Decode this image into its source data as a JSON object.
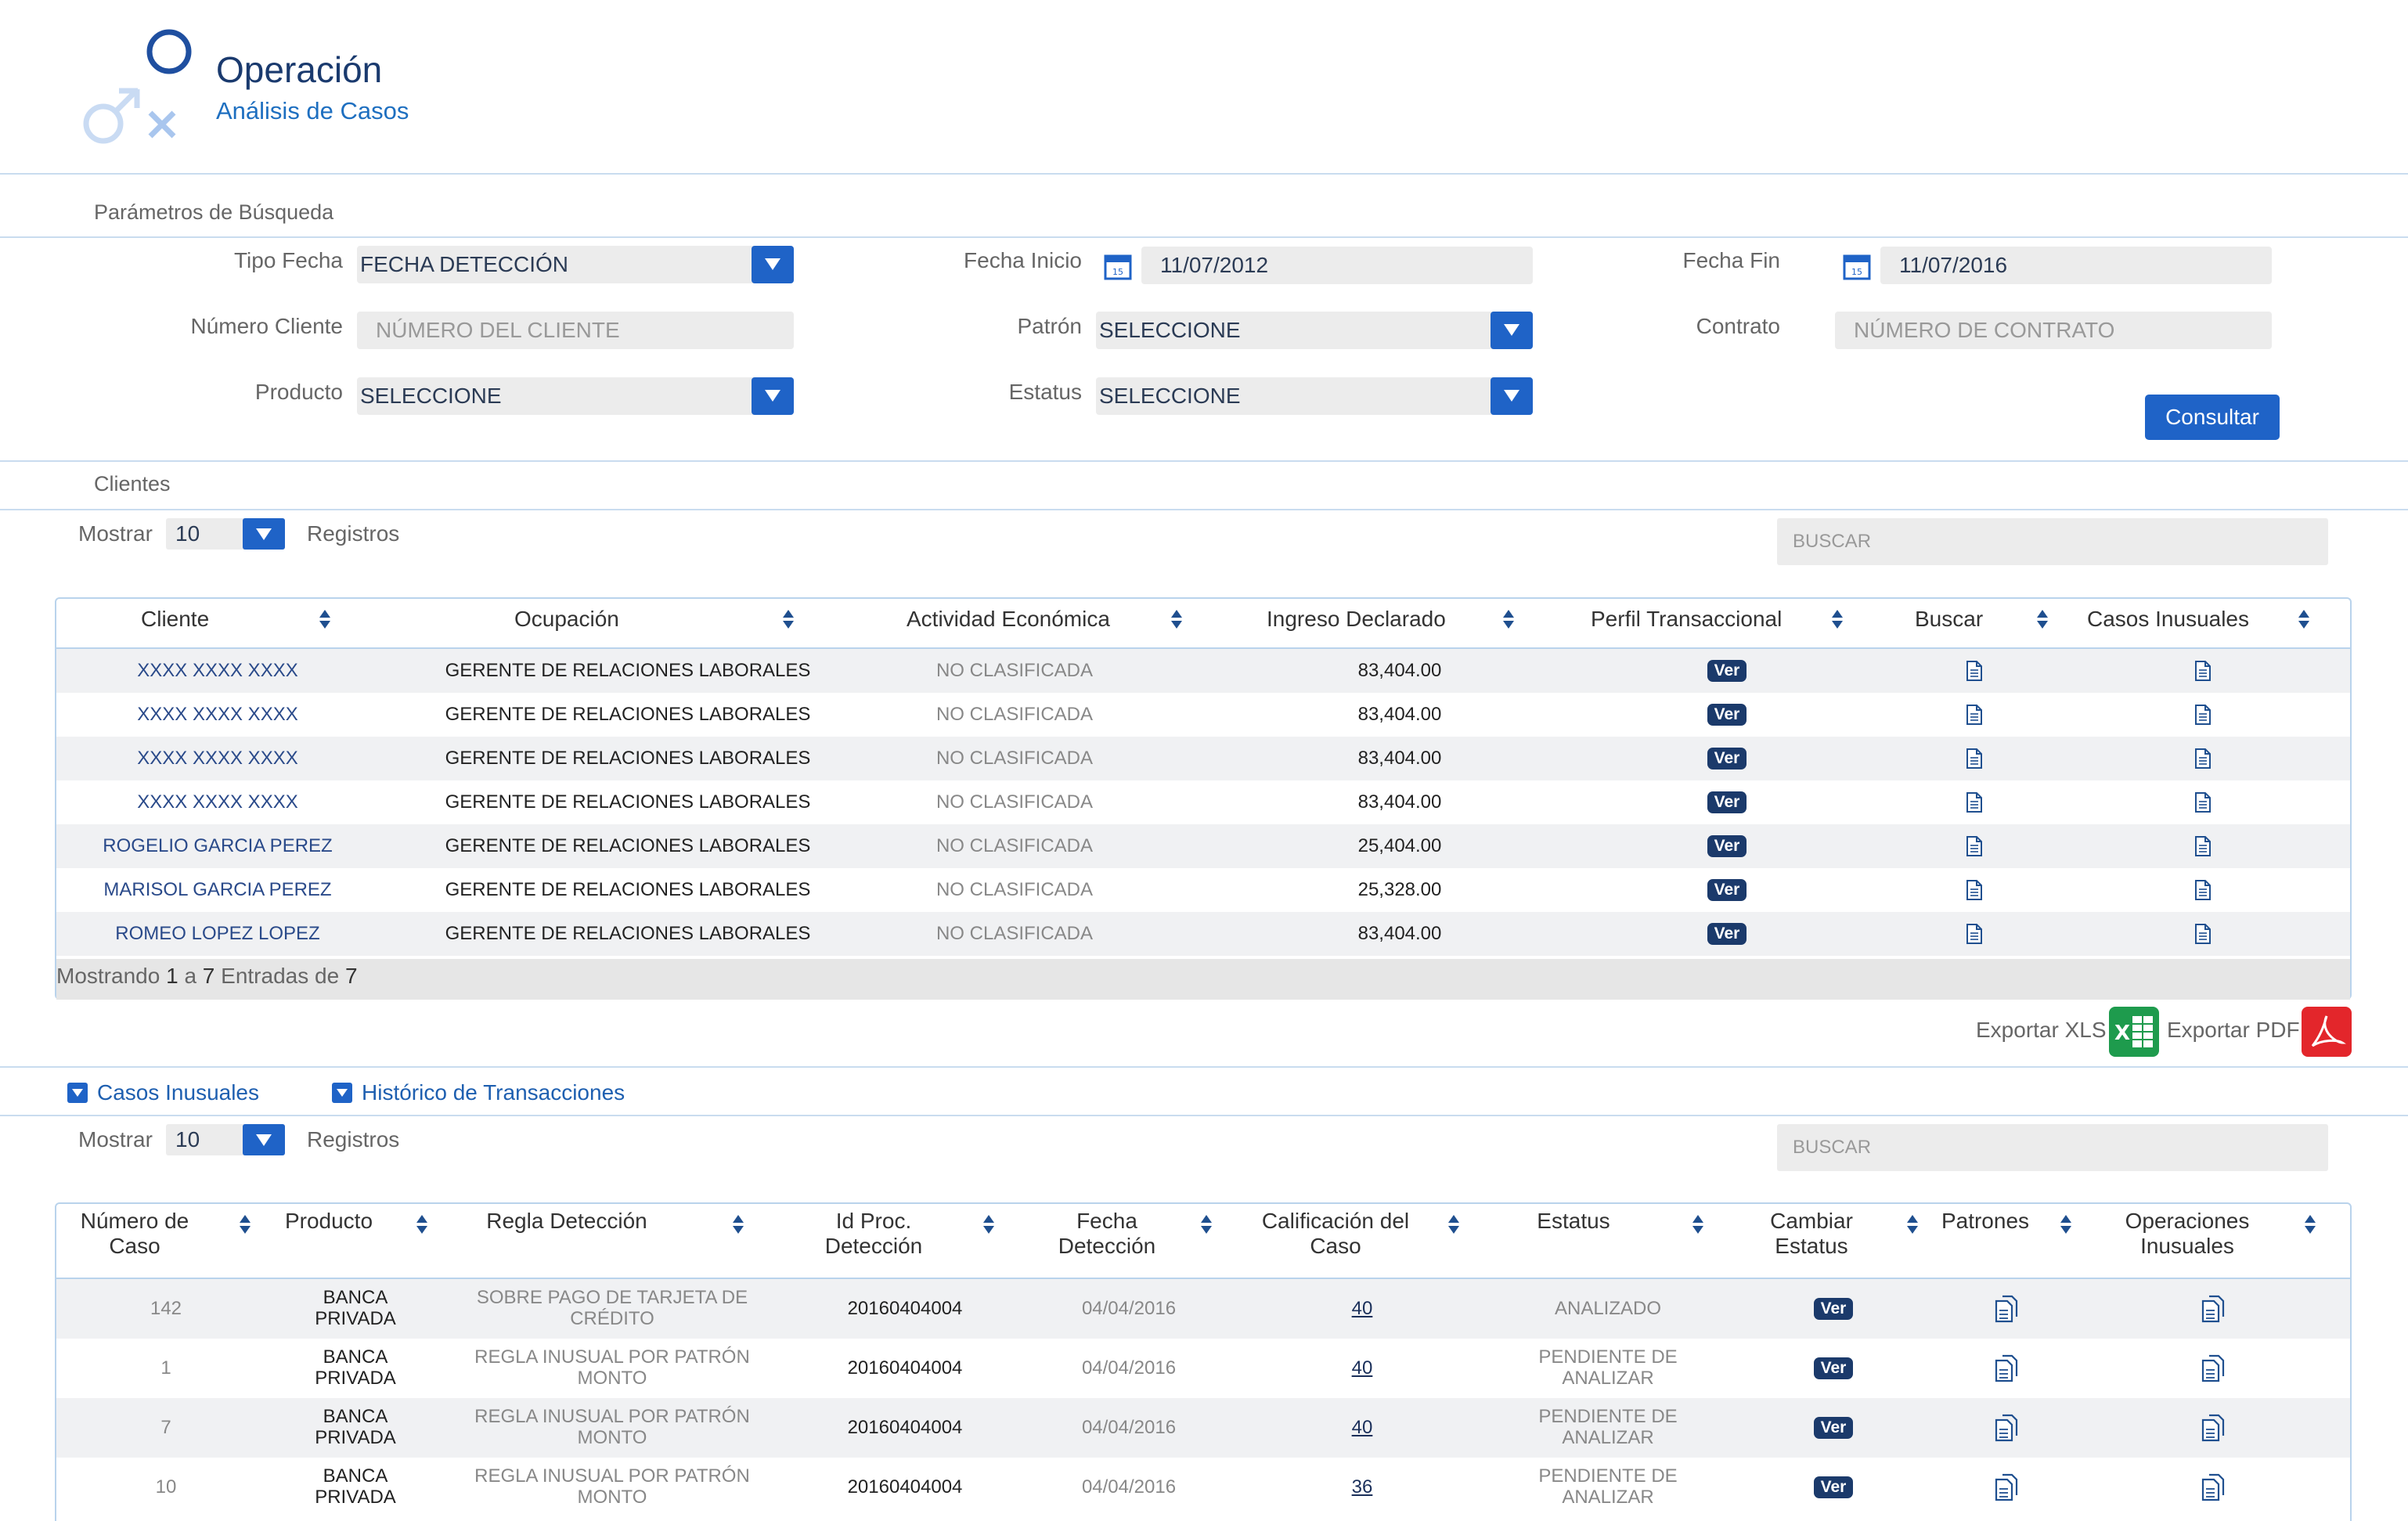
{
  "header": {
    "title": "Operación",
    "subtitle": "Análisis de Casos"
  },
  "search_params": {
    "section_title": "Parámetros de Búsqueda",
    "tipo_fecha": {
      "label": "Tipo Fecha",
      "value": "FECHA DETECCIÓN"
    },
    "fecha_inicio": {
      "label": "Fecha Inicio",
      "value": "11/07/2012"
    },
    "fecha_fin": {
      "label": "Fecha Fin",
      "value": "11/07/2016"
    },
    "numero_cliente": {
      "label": "Número Cliente",
      "placeholder": "NÚMERO DEL CLIENTE"
    },
    "patron": {
      "label": "Patrón",
      "value": "SELECCIONE"
    },
    "contrato": {
      "label": "Contrato",
      "placeholder": "NÚMERO DE CONTRATO"
    },
    "producto": {
      "label": "Producto",
      "value": "SELECCIONE"
    },
    "estatus": {
      "label": "Estatus",
      "value": "SELECCIONE"
    },
    "consultar_label": "Consultar"
  },
  "clientes": {
    "section_title": "Clientes",
    "mostrar_label": "Mostrar",
    "page_size": "10",
    "registros_label": "Registros",
    "search_placeholder": "BUSCAR",
    "columns": [
      "Cliente",
      "Ocupación",
      "Actividad Económica",
      "Ingreso Declarado",
      "Perfil Transaccional",
      "Buscar",
      "Casos Inusuales"
    ],
    "rows": [
      {
        "cliente": "XXXX XXXX XXXX",
        "ocupacion": "GERENTE DE RELACIONES LABORALES",
        "actividad": "NO CLASIFICADA",
        "ingreso": "83,404.00",
        "perfil": "Ver"
      },
      {
        "cliente": "XXXX XXXX XXXX",
        "ocupacion": "GERENTE DE RELACIONES LABORALES",
        "actividad": "NO CLASIFICADA",
        "ingreso": "83,404.00",
        "perfil": "Ver"
      },
      {
        "cliente": "XXXX XXXX XXXX",
        "ocupacion": "GERENTE DE RELACIONES LABORALES",
        "actividad": "NO CLASIFICADA",
        "ingreso": "83,404.00",
        "perfil": "Ver"
      },
      {
        "cliente": "XXXX XXXX XXXX",
        "ocupacion": "GERENTE DE RELACIONES LABORALES",
        "actividad": "NO CLASIFICADA",
        "ingreso": "83,404.00",
        "perfil": "Ver"
      },
      {
        "cliente": "ROGELIO GARCIA PEREZ",
        "ocupacion": "GERENTE DE RELACIONES LABORALES",
        "actividad": "NO CLASIFICADA",
        "ingreso": "25,404.00",
        "perfil": "Ver"
      },
      {
        "cliente": "MARISOL GARCIA PEREZ",
        "ocupacion": "GERENTE DE RELACIONES LABORALES",
        "actividad": "NO CLASIFICADA",
        "ingreso": "25,328.00",
        "perfil": "Ver"
      },
      {
        "cliente": "ROMEO LOPEZ LOPEZ",
        "ocupacion": "GERENTE DE RELACIONES LABORALES",
        "actividad": "NO CLASIFICADA",
        "ingreso": "83,404.00",
        "perfil": "Ver"
      }
    ],
    "footer": {
      "prefix": "Mostrando",
      "from": "1",
      "a": "a",
      "to": "7",
      "mid": "Entradas de",
      "total": "7"
    },
    "export_xls": "Exportar XLS",
    "export_pdf": "Exportar PDF"
  },
  "tabs": {
    "casos_inusuales": "Casos Inusuales",
    "historico": "Histórico de Transacciones"
  },
  "casos": {
    "mostrar_label": "Mostrar",
    "page_size": "10",
    "registros_label": "Registros",
    "search_placeholder": "BUSCAR",
    "columns": [
      [
        "Número de",
        "Caso"
      ],
      [
        "Producto",
        ""
      ],
      [
        "Regla Detección",
        ""
      ],
      [
        "Id Proc.",
        "Detección"
      ],
      [
        "Fecha",
        "Detección"
      ],
      [
        "Calificación del",
        "Caso"
      ],
      [
        "Estatus",
        ""
      ],
      [
        "Cambiar",
        "Estatus"
      ],
      [
        "Patrones",
        ""
      ],
      [
        "Operaciones",
        "Inusuales"
      ]
    ],
    "rows": [
      {
        "numero": "142",
        "producto": [
          "BANCA",
          "PRIVADA"
        ],
        "regla": [
          "SOBRE PAGO DE TARJETA DE",
          "CRÉDITO"
        ],
        "id_proc": "20160404004",
        "fecha": "04/04/2016",
        "calificacion": "40",
        "estatus": [
          "ANALIZADO",
          ""
        ],
        "cambiar": "Ver"
      },
      {
        "numero": "1",
        "producto": [
          "BANCA",
          "PRIVADA"
        ],
        "regla": [
          "REGLA INUSUAL POR PATRÓN",
          "MONTO"
        ],
        "id_proc": "20160404004",
        "fecha": "04/04/2016",
        "calificacion": "40",
        "estatus": [
          "PENDIENTE DE",
          "ANALIZAR"
        ],
        "cambiar": "Ver"
      },
      {
        "numero": "7",
        "producto": [
          "BANCA",
          "PRIVADA"
        ],
        "regla": [
          "REGLA INUSUAL POR PATRÓN",
          "MONTO"
        ],
        "id_proc": "20160404004",
        "fecha": "04/04/2016",
        "calificacion": "40",
        "estatus": [
          "PENDIENTE DE",
          "ANALIZAR"
        ],
        "cambiar": "Ver"
      },
      {
        "numero": "10",
        "producto": [
          "BANCA",
          "PRIVADA"
        ],
        "regla": [
          "REGLA INUSUAL POR PATRÓN",
          "MONTO"
        ],
        "id_proc": "20160404004",
        "fecha": "04/04/2016",
        "calificacion": "36",
        "estatus": [
          "PENDIENTE DE",
          "ANALIZAR"
        ],
        "cambiar": "Ver"
      }
    ]
  },
  "colors": {
    "accent": "#1f63c7",
    "navy": "#1b3a6b",
    "border": "#b9d3ec",
    "xls": "#1e9b4d",
    "pdf": "#e3262b"
  },
  "icons": [
    "gender-symbols-logo",
    "calendar-icon",
    "document-icon",
    "documents-icon",
    "excel-icon",
    "pdf-icon",
    "sort-icon",
    "dropdown-arrow-icon"
  ]
}
